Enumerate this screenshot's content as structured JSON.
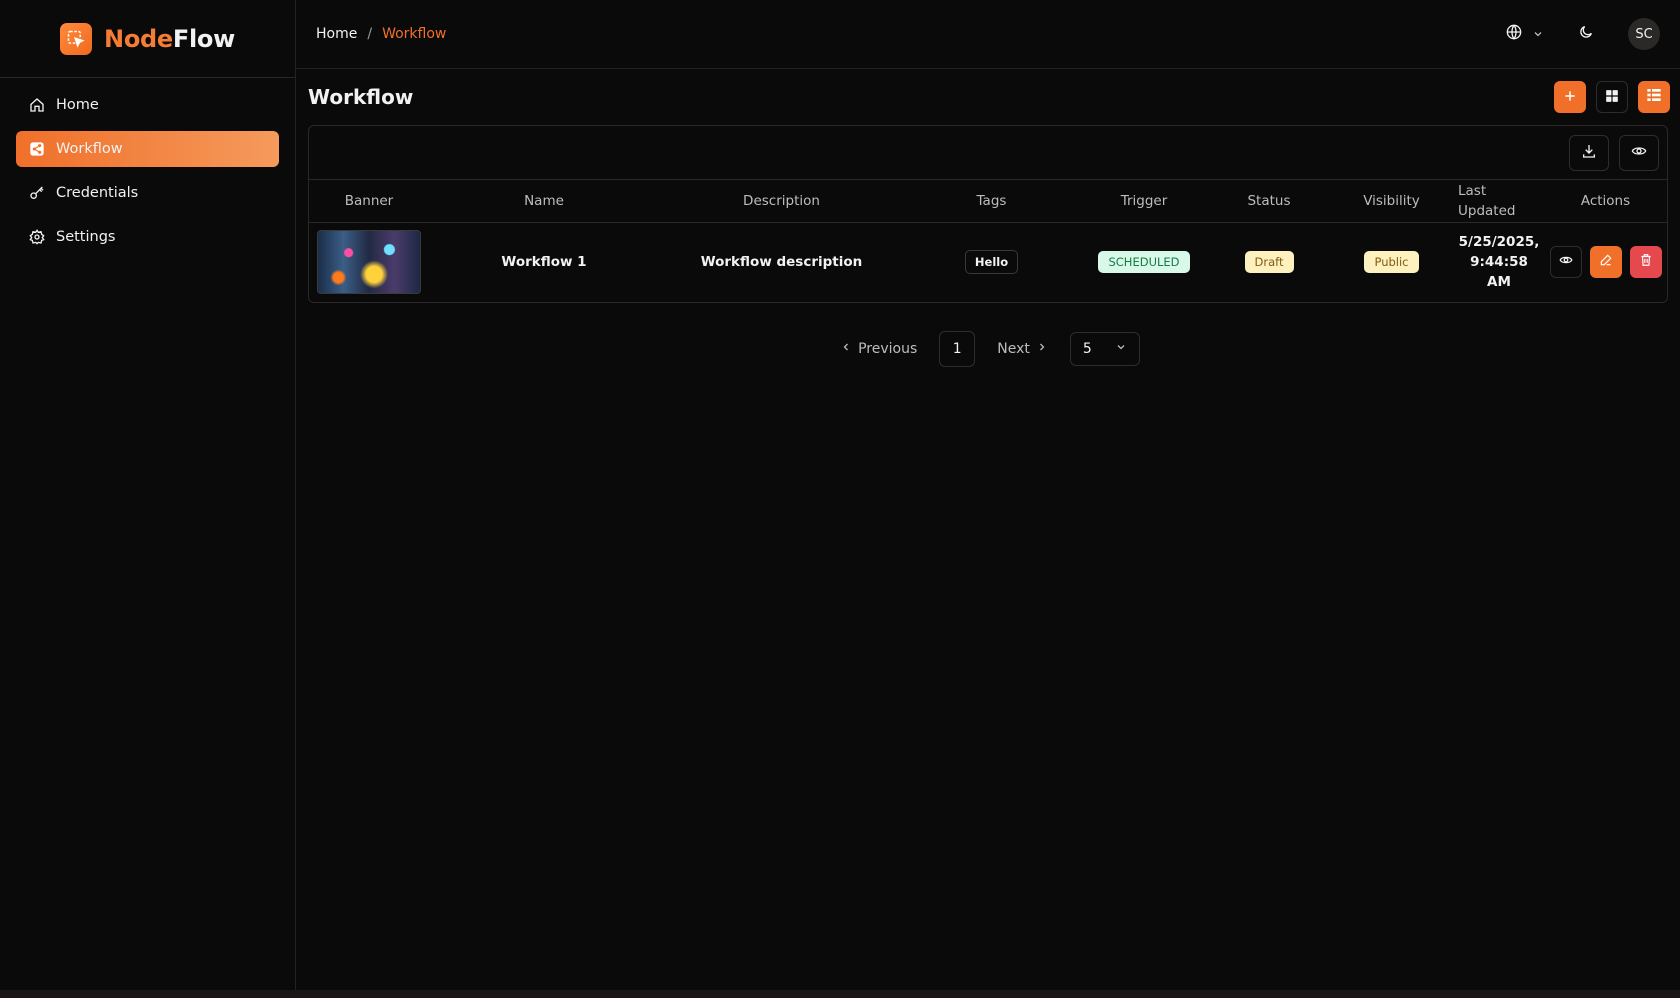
{
  "brand": {
    "part1": "Node",
    "part2": "Flow"
  },
  "sidebar": {
    "items": [
      {
        "label": "Home",
        "icon": "home-icon",
        "active": false
      },
      {
        "label": "Workflow",
        "icon": "workflow-icon",
        "active": true
      },
      {
        "label": "Credentials",
        "icon": "key-icon",
        "active": false
      },
      {
        "label": "Settings",
        "icon": "gear-icon",
        "active": false
      }
    ]
  },
  "breadcrumb": {
    "home": "Home",
    "separator": "/",
    "current": "Workflow"
  },
  "topbar": {
    "avatar_initials": "SC",
    "icons": [
      "globe-icon",
      "chevron-down-icon",
      "moon-icon"
    ]
  },
  "page": {
    "title": "Workflow"
  },
  "table": {
    "headers": {
      "banner": "Banner",
      "name": "Name",
      "description": "Description",
      "tags": "Tags",
      "trigger": "Trigger",
      "status": "Status",
      "visibility": "Visibility",
      "last_updated_1": "Last",
      "last_updated_2": "Updated",
      "actions": "Actions"
    },
    "rows": [
      {
        "name": "Workflow 1",
        "description": "Workflow description",
        "tag": "Hello",
        "trigger": "SCHEDULED",
        "status": "Draft",
        "visibility": "Public",
        "date_1": "5/25/2025,",
        "date_2": "9:44:58",
        "date_3": "AM"
      }
    ]
  },
  "pagination": {
    "previous": "Previous",
    "page": "1",
    "next": "Next",
    "page_size": "5"
  },
  "colors": {
    "accent": "#f0702a",
    "danger": "#e5484d",
    "background": "#0b0a0a"
  }
}
